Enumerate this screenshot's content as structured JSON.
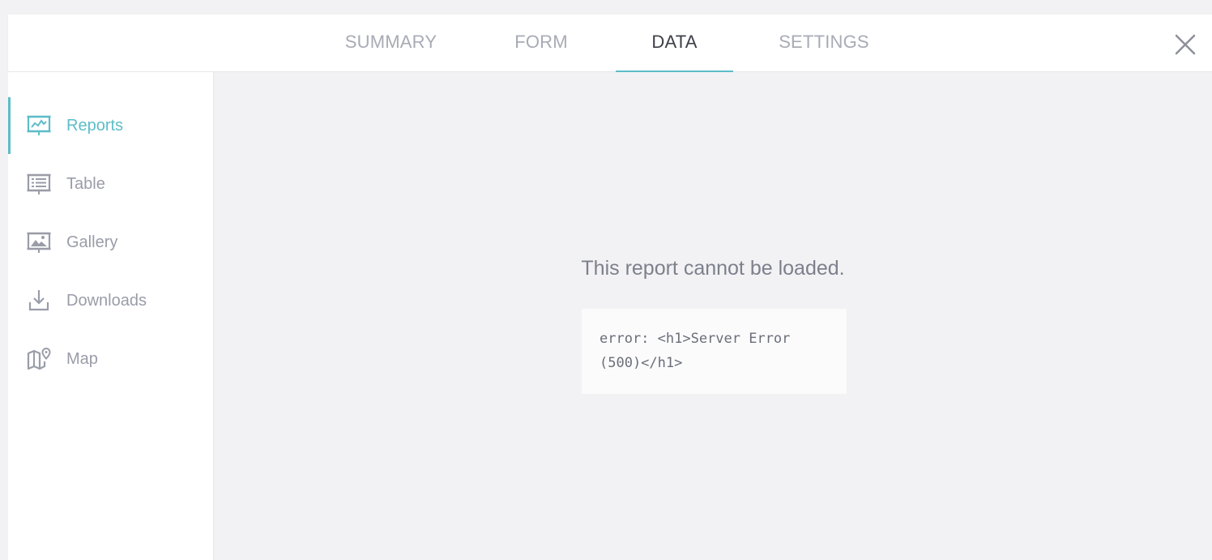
{
  "tabs": [
    {
      "label": "SUMMARY",
      "active": false
    },
    {
      "label": "FORM",
      "active": false
    },
    {
      "label": "DATA",
      "active": true
    },
    {
      "label": "SETTINGS",
      "active": false
    }
  ],
  "close_icon": "close-icon",
  "sidebar": {
    "items": [
      {
        "label": "Reports",
        "icon": "reports-icon",
        "active": true
      },
      {
        "label": "Table",
        "icon": "table-icon",
        "active": false
      },
      {
        "label": "Gallery",
        "icon": "gallery-icon",
        "active": false
      },
      {
        "label": "Downloads",
        "icon": "download-icon",
        "active": false
      },
      {
        "label": "Map",
        "icon": "map-icon",
        "active": false
      }
    ]
  },
  "main": {
    "error_title": "This report cannot be loaded.",
    "error_message": "error: <h1>Server Error (500)</h1>"
  },
  "colors": {
    "accent": "#5dbdc8",
    "inactive_text": "#a8abb5",
    "active_text": "#3e4049",
    "background": "#f2f2f4"
  }
}
